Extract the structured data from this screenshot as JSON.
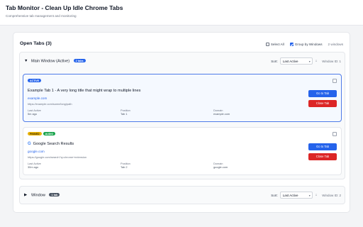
{
  "header": {
    "title": "Tab Monitor - Clean Up Idle Chrome Tabs",
    "subtitle": "Comprehensive tab management and monitoring"
  },
  "panel": {
    "title": "Open Tabs (3)",
    "select_all_label": "Select All",
    "group_by_label": "Group by Windows",
    "window_count": "2 windows"
  },
  "windows": [
    {
      "caret": "▼",
      "title": "Main Window (Active)",
      "badge": "2 tabs",
      "sort_label": "Sort:",
      "sort_value": "Last Active",
      "sort_arrow": "↓",
      "window_id": "Window ID: 1",
      "tabs": [
        {
          "badges": [
            "ACTIVE"
          ],
          "title": "Example Tab 1 - A very long title that might wrap to multiple lines",
          "domain_link": "example.com",
          "url": "https://example.com/some/long/path",
          "meta": [
            {
              "label": "Last Active",
              "value": "5m ago"
            },
            {
              "label": "Position",
              "value": "Tab 1"
            },
            {
              "label": "Domain",
              "value": "example.com"
            }
          ],
          "go_label": "Go to Tab",
          "close_label": "Close Tab"
        },
        {
          "badges": [
            "PINNED",
            "AUDIO"
          ],
          "favicon": "G",
          "title": "Google Search Results",
          "domain_link": "google.com",
          "url": "https://google.com/search?q=chrome+extension",
          "meta": [
            {
              "label": "Last Active",
              "value": "30m ago"
            },
            {
              "label": "Position",
              "value": "Tab 2"
            },
            {
              "label": "Domain",
              "value": "google.com"
            }
          ],
          "go_label": "Go to Tab",
          "close_label": "Close Tab"
        }
      ]
    },
    {
      "caret": "▶",
      "title": "Window",
      "badge": "1 tab",
      "sort_label": "Sort:",
      "sort_value": "Last Active",
      "sort_arrow": "↓",
      "window_id": "Window ID: 2"
    }
  ],
  "icons": {
    "expand": "caret-down-icon",
    "collapse": "caret-right-icon",
    "favicon": "google-g-icon",
    "sort_direction": "arrow-down-icon",
    "dropdown": "chevron-down-icon"
  },
  "colors": {
    "primary": "#2563eb",
    "danger": "#dc2626",
    "pinned": "#eab308",
    "audio": "#16a34a",
    "active_border": "#4f7be8"
  }
}
